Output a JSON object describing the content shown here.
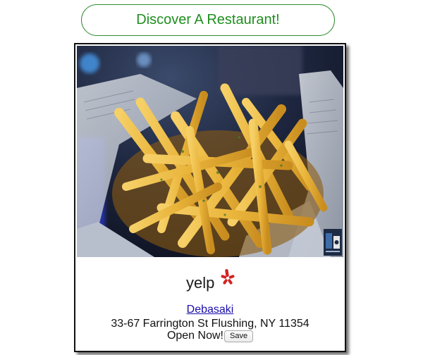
{
  "header": {
    "discover_label": "Discover A Restaurant!"
  },
  "card": {
    "photo_description_icon": "fries-photo",
    "brand_logo_text": "yelp",
    "restaurant_name": "Debasaki",
    "address": "33-67 Farrington St Flushing, NY 11354",
    "status": "Open Now!",
    "save_label": "Save"
  },
  "colors": {
    "discover_border": "#2e8b2e",
    "discover_text": "#1f8f1f",
    "link": "#1a0dab",
    "yelp_burst": "#d32323"
  }
}
